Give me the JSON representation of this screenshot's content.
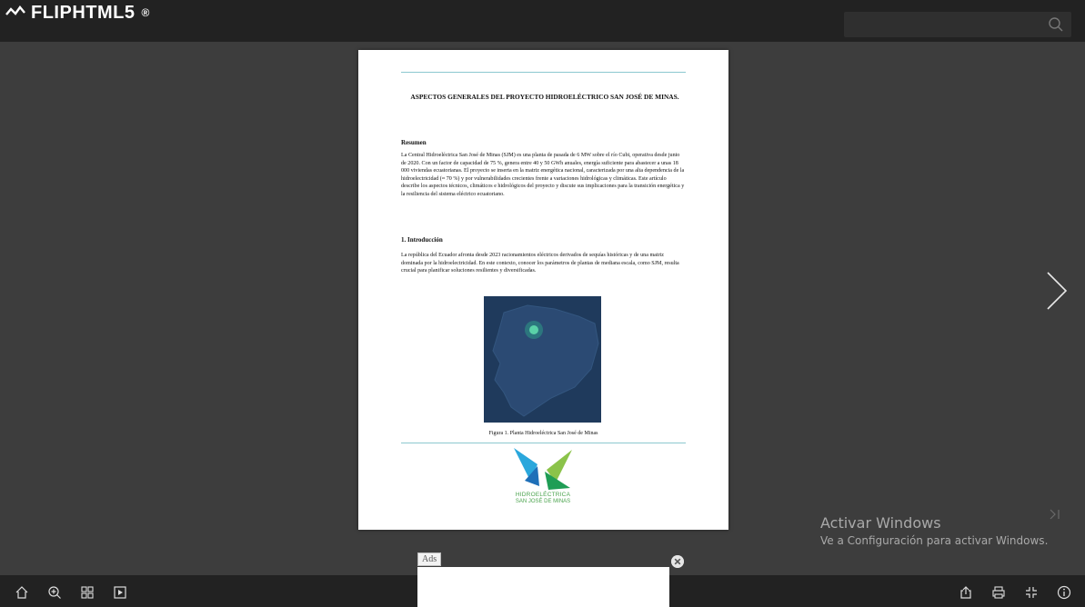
{
  "header": {
    "brand": "FLIPHTML5",
    "brand_mark": "®",
    "search_placeholder": ""
  },
  "document": {
    "title": "ASPECTOS GENERALES DEL PROYECTO HIDROELÉCTRICO SAN JOSÉ DE MINAS.",
    "resumen_heading": "Resumen",
    "resumen_text": "La Central Hidroeléctrica San José de Minas (SJM) es una planta de pasada de 6 MW sobre el río Cubi, operativa desde junio de 2020. Con un factor de capacidad de 75 %, genera entre 40 y 50 GWh anuales, energía suficiente para abastecer a unas 18 000 viviendas ecuatorianas. El proyecto se inserta en la matriz energética nacional, caracterizada por una alta dependencia de la hidroelectricidad (≈ 70 %) y por vulnerabilidades crecientes frente a variaciones hidrológicas y climáticas. Este artículo describe los aspectos técnicos, climáticos e hidrológicos del proyecto y discute sus implicaciones para la transición energética y la resiliencia del sistema eléctrico ecuatoriano.",
    "intro_heading": "1. Introducción",
    "intro_text": "La república del Ecuador afronta desde 2023 racionamientos eléctricos derivados de sequías históricas y de una matriz dominada por la hidroelectricidad. En este contexto, conocer los parámetros de plantas de mediana escala, como SJM, resulta crucial para planificar soluciones resilientes y diversificadas.",
    "figure_caption": "Figura 1. Planta Hidroeléctrica San José de Minas",
    "logo_line1": "HIDROELÉCTRICA",
    "logo_line2": "SAN JOSÉ DE MINAS"
  },
  "watermark": {
    "line1": "Activar Windows",
    "line2": "Ve a Configuración para activar Windows."
  },
  "ads": {
    "label": "Ads"
  },
  "nav": {
    "next_icon": "chevron-right-icon",
    "last_icon": "skip-to-end-icon"
  },
  "bottom_toolbar": {
    "left": [
      "home-icon",
      "zoom-in-icon",
      "thumbnails-icon",
      "autoplay-icon"
    ],
    "right": [
      "share-icon",
      "print-icon",
      "exit-fullscreen-icon",
      "info-icon"
    ]
  },
  "colors": {
    "topbar": "#222222",
    "background": "#3d3d3d",
    "accent_rule": "#8cc8cf",
    "logo_green": "#4aa34d"
  }
}
